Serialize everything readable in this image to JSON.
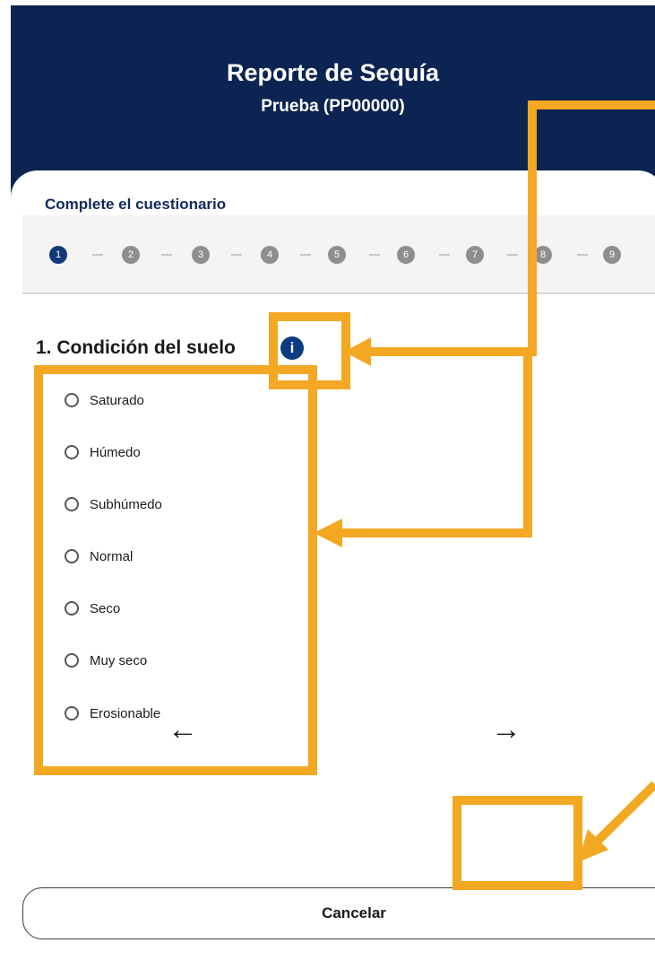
{
  "header": {
    "title": "Reporte de Sequía",
    "subtitle": "Prueba (PP00000)"
  },
  "card": {
    "label": "Complete el cuestionario"
  },
  "stepper": {
    "steps": [
      "1",
      "2",
      "3",
      "4",
      "5",
      "6",
      "7",
      "8",
      "9"
    ]
  },
  "question": {
    "text": "1. Condición del suelo",
    "info_icon": "info-icon"
  },
  "options": [
    "Saturado",
    "Húmedo",
    "Subhúmedo",
    "Normal",
    "Seco",
    "Muy seco",
    "Erosionable"
  ],
  "navigation": {
    "back_icon": "arrow-left-icon",
    "next_icon": "arrow-right-icon"
  },
  "cancel_label": "Cancelar",
  "colors": {
    "header": "#0c2452",
    "accent": "#f3a823",
    "step_active": "#123a78"
  }
}
